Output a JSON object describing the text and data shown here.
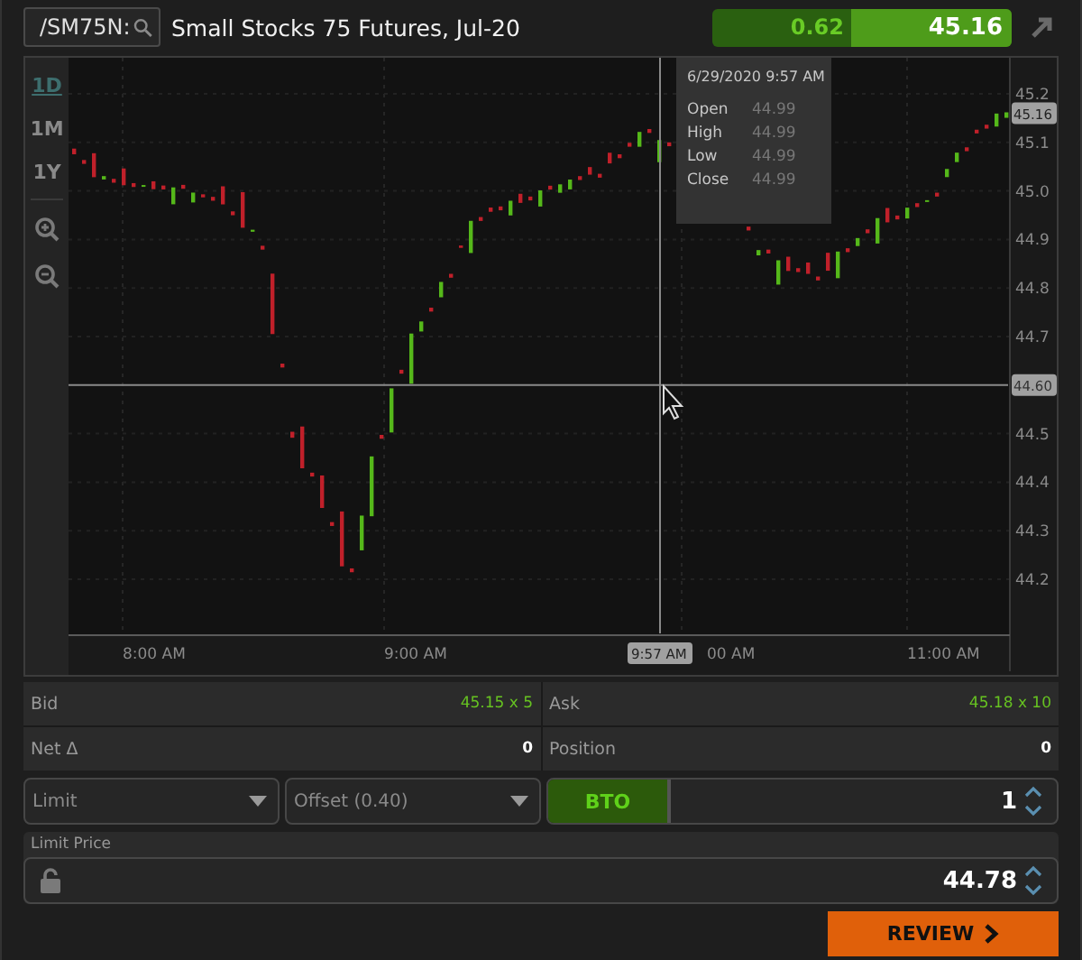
{
  "header": {
    "symbol": "/SM75N:",
    "title": "Small Stocks 75 Futures, Jul-20",
    "change": "0.62",
    "last": "45.16"
  },
  "chart": {
    "ranges": [
      {
        "label": "1D",
        "selected": true
      },
      {
        "label": "1M",
        "selected": false
      },
      {
        "label": "1Y",
        "selected": false
      }
    ],
    "tooltip": {
      "date": "6/29/2020 9:57 AM",
      "rows": [
        {
          "label": "Open",
          "value": "44.99"
        },
        {
          "label": "High",
          "value": "44.99"
        },
        {
          "label": "Low",
          "value": "44.99"
        },
        {
          "label": "Close",
          "value": "44.99"
        }
      ]
    },
    "price_ticks": [
      "45.2",
      "45.1",
      "45.0",
      "44.9",
      "44.8",
      "44.7",
      "44.5",
      "44.4",
      "44.3",
      "44.2"
    ],
    "time_ticks": [
      "8:00 AM",
      "9:00 AM",
      "00 AM",
      "11:00 AM"
    ],
    "last_price_badge": "45.16",
    "crosshair": {
      "time": "9:57 AM",
      "price": "44.60"
    }
  },
  "quote": [
    {
      "label": "Bid",
      "value": "45.15 x 5",
      "kind": "quote"
    },
    {
      "label": "Ask",
      "value": "45.18 x 10",
      "kind": "quote"
    },
    {
      "label": "Net Δ",
      "value": "0",
      "kind": "count"
    },
    {
      "label": "Position",
      "value": "0",
      "kind": "count"
    }
  ],
  "order": {
    "type": "Limit",
    "link": "Offset (0.40)",
    "side": "BTO",
    "quantity": "1",
    "limit_price_label": "Limit Price",
    "limit_price": "44.78",
    "review": "REVIEW"
  }
}
